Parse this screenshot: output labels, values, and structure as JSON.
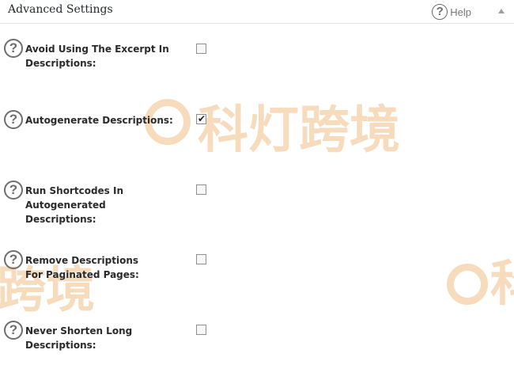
{
  "panel": {
    "title": "Advanced Settings",
    "help_label": "Help"
  },
  "settings": [
    {
      "label": "Avoid Using The Excerpt In Descriptions:",
      "checked": false
    },
    {
      "label": "Autogenerate Descriptions:",
      "checked": true
    },
    {
      "label": "Run Shortcodes In Autogenerated Descriptions:",
      "checked": false
    },
    {
      "label": "Remove Descriptions For Paginated Pages:",
      "checked": false
    },
    {
      "label": "Never Shorten Long Descriptions:",
      "checked": false
    }
  ],
  "watermark": {
    "text_main": "科灯跨境",
    "text_left": "跨境",
    "text_right": "科"
  },
  "icons": {
    "help": "question-circle-icon",
    "collapse": "triangle-up-icon",
    "checkbox_mark": "checkmark-icon"
  },
  "glyphs": {
    "question": "?",
    "check": "✔"
  }
}
